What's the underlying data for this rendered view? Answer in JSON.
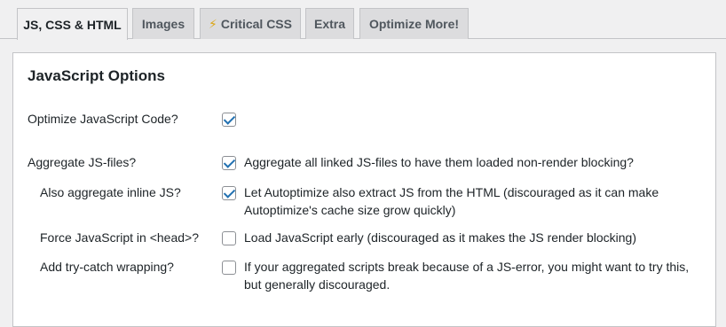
{
  "tabs": [
    {
      "label": "JS, CSS & HTML",
      "active": true
    },
    {
      "label": "Images",
      "active": false
    },
    {
      "label": "Critical CSS",
      "active": false,
      "icon": "lightning-bolt-icon"
    },
    {
      "label": "Extra",
      "active": false
    },
    {
      "label": "Optimize More!",
      "active": false
    }
  ],
  "section": {
    "title": "JavaScript Options"
  },
  "options": [
    {
      "label": "Optimize JavaScript Code?",
      "checked": true,
      "description": ""
    },
    {
      "label": "Aggregate JS-files?",
      "checked": true,
      "description": "Aggregate all linked JS-files to have them loaded non-render blocking?"
    },
    {
      "label": "Also aggregate inline JS?",
      "checked": true,
      "description": "Let Autoptimize also extract JS from the HTML (discouraged as it can make Autoptimize's cache size grow quickly)"
    },
    {
      "label": "Force JavaScript in <head>?",
      "checked": false,
      "description": "Load JavaScript early (discouraged as it makes the JS render blocking)"
    },
    {
      "label": "Add try-catch wrapping?",
      "checked": false,
      "description": "If your aggregated scripts break because of a JS-error, you might want to try this, but generally discouraged."
    }
  ],
  "colors": {
    "accent": "#2271b1",
    "bolt": "#dba617"
  }
}
